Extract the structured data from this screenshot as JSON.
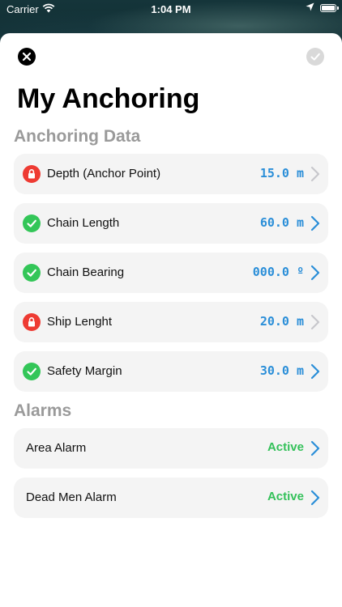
{
  "status_bar": {
    "carrier": "Carrier",
    "time": "1:04 PM"
  },
  "header": {
    "title": "My Anchoring",
    "close_icon": "close-icon",
    "done_icon": "checkmark-icon"
  },
  "anchoring": {
    "section_title": "Anchoring Data",
    "items": [
      {
        "label": "Depth (Anchor Point)",
        "value": "15.0 m",
        "status": "locked",
        "enabled": false
      },
      {
        "label": "Chain Length",
        "value": "60.0 m",
        "status": "ok",
        "enabled": true
      },
      {
        "label": "Chain Bearing",
        "value": "000.0 º",
        "status": "ok",
        "enabled": true
      },
      {
        "label": "Ship Lenght",
        "value": "20.0 m",
        "status": "locked",
        "enabled": false
      },
      {
        "label": "Safety Margin",
        "value": "30.0 m",
        "status": "ok",
        "enabled": true
      }
    ]
  },
  "alarms": {
    "section_title": "Alarms",
    "items": [
      {
        "label": "Area Alarm",
        "value": "Active"
      },
      {
        "label": "Dead Men Alarm",
        "value": "Active"
      }
    ]
  },
  "colors": {
    "accent_blue": "#2a8ed8",
    "active_green": "#34c15a",
    "ok_green": "#33c658",
    "lock_red": "#ee3b33",
    "chevron_disabled": "#c7c7cc"
  }
}
